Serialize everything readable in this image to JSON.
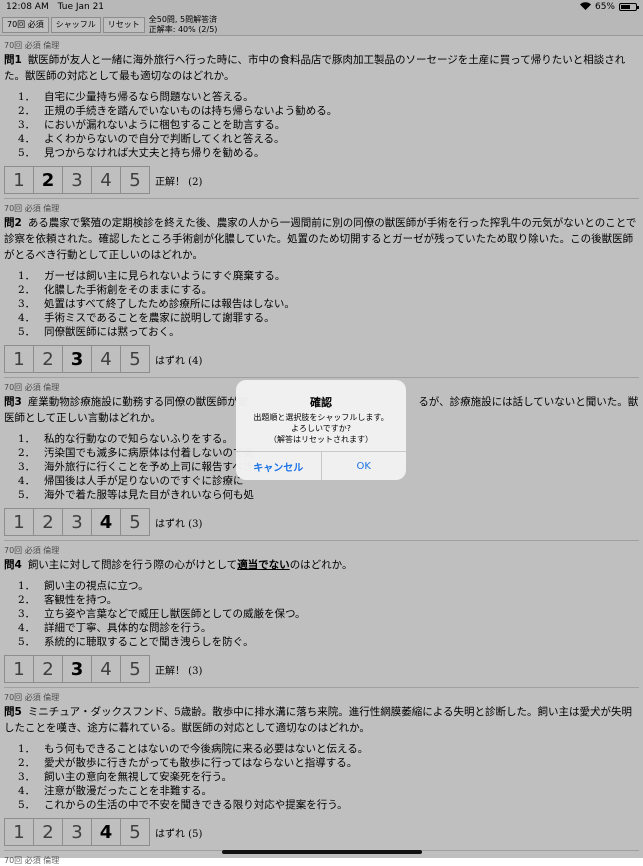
{
  "status": {
    "time": "12:08 AM",
    "date": "Tue Jan 21",
    "battery": "65%",
    "battery_level": 0.65
  },
  "toolbar": {
    "round_label": "70回 必須",
    "shuffle_label": "シャッフル",
    "reset_label": "リセット",
    "info_line1": "全50問, 5問解答済",
    "info_line2": "正解率: 40% (2/5)"
  },
  "questions": [
    {
      "tag": "70回 必須 倫理",
      "num": "問1",
      "text": "獣医師が友人と一緒に海外旅行へ行った時に、市中の食料品店で豚肉加工製品のソーセージを土産に買って帰りたいと相談された。獣医師の対応として最も適切なのはどれか。",
      "choices": [
        {
          "n": "1．",
          "t": "自宅に少量持ち帰るなら問題ないと答える。"
        },
        {
          "n": "2．",
          "t": "正規の手続きを踏んでいないものは持ち帰らないよう勧める。"
        },
        {
          "n": "3．",
          "t": "においが漏れないように梱包することを助言する。"
        },
        {
          "n": "4．",
          "t": "よくわからないので自分で判断してくれと答える。"
        },
        {
          "n": "5．",
          "t": "見つからなければ大丈夫と持ち帰りを勧める。"
        }
      ],
      "result": "正解！ (2)"
    },
    {
      "tag": "70回 必須 倫理",
      "num": "問2",
      "text": "ある農家で繁殖の定期検診を終えた後、農家の人から一週間前に別の同僚の獣医師が手術を行った搾乳牛の元気がないとのことで診察を依頼された。確認したところ手術創が化膿していた。処置のため切開するとガーゼが残っていたため取り除いた。この後獣医師がとるべき行動として正しいのはどれか。",
      "choices": [
        {
          "n": "1．",
          "t": "ガーゼは飼い主に見られないようにすぐ廃棄する。"
        },
        {
          "n": "2．",
          "t": "化膿した手術創をそのままにする。"
        },
        {
          "n": "3．",
          "t": "処置はすべて終了したため診療所には報告はしない。"
        },
        {
          "n": "4．",
          "t": "手術ミスであることを農家に説明して謝罪する。"
        },
        {
          "n": "5．",
          "t": "同僚獣医師には黙っておく。"
        }
      ],
      "result": "はずれ (4)"
    },
    {
      "tag": "70回 必須 倫理",
      "num": "問3",
      "text": "産業動物診療施設に勤務する同僚の獣医師が夏",
      "text_tail": "るが、診療施設には話していないと聞いた。獣医師として正しい言動はどれか。",
      "choices": [
        {
          "n": "1．",
          "t": "私的な行動なので知らないふりをする。"
        },
        {
          "n": "2．",
          "t": "汚染国でも滅多に病原体は付着しないので気"
        },
        {
          "n": "3．",
          "t": "海外旅行に行くことを予め上司に報告すべき"
        },
        {
          "n": "4．",
          "t": "帰国後は人手が足りないのですぐに診療に"
        },
        {
          "n": "5．",
          "t": "海外で着た服等は見た目がきれいなら何も処"
        }
      ],
      "result": "はずれ (3)"
    },
    {
      "tag": "70回 必須 倫理",
      "num": "問4",
      "text_pre": "飼い主に対して問診を行う際の心がけとして",
      "text_em": "適当でない",
      "text_post": "のはどれか。",
      "choices": [
        {
          "n": "1．",
          "t": "飼い主の視点に立つ。"
        },
        {
          "n": "2．",
          "t": "客観性を持つ。"
        },
        {
          "n": "3．",
          "t": "立ち姿や言葉などで威圧し獣医師としての威厳を保つ。"
        },
        {
          "n": "4．",
          "t": "詳細で丁寧、具体的な問診を行う。"
        },
        {
          "n": "5．",
          "t": "系統的に聴取することで聞き洩らしを防ぐ。"
        }
      ],
      "result": "正解！ (3)"
    },
    {
      "tag": "70回 必須 倫理",
      "num": "問5",
      "text": "ミニチュア・ダックスフンド、5歳齢。散歩中に排水溝に落ち来院。進行性網膜萎縮による失明と診断した。飼い主は愛犬が失明したことを嘆き、途方に暮れている。獣医師の対応として適切なのはどれか。",
      "choices": [
        {
          "n": "1．",
          "t": "もう何もできることはないので今後病院に来る必要はないと伝える。"
        },
        {
          "n": "2．",
          "t": "愛犬が散歩に行きたがっても散歩に行ってはならないと指導する。"
        },
        {
          "n": "3．",
          "t": "飼い主の意向を無視して安楽死を行う。"
        },
        {
          "n": "4．",
          "t": "注意が散漫だったことを非難する。"
        },
        {
          "n": "5．",
          "t": "これからの生活の中で不安を聞きできる限り対応や提案を行う。"
        }
      ],
      "result": "はずれ (5)"
    }
  ],
  "selected": [
    2,
    3,
    4,
    3,
    4
  ],
  "next_tag": "70回 必須 倫理",
  "answer_buttons": [
    "1",
    "2",
    "3",
    "4",
    "5"
  ],
  "dialog": {
    "title": "確認",
    "line1": "出題順と選択肢をシャッフルします。",
    "line2": "よろしいですか?",
    "line3": "（解答はリセットされます）",
    "cancel": "キャンセル",
    "ok": "OK"
  }
}
